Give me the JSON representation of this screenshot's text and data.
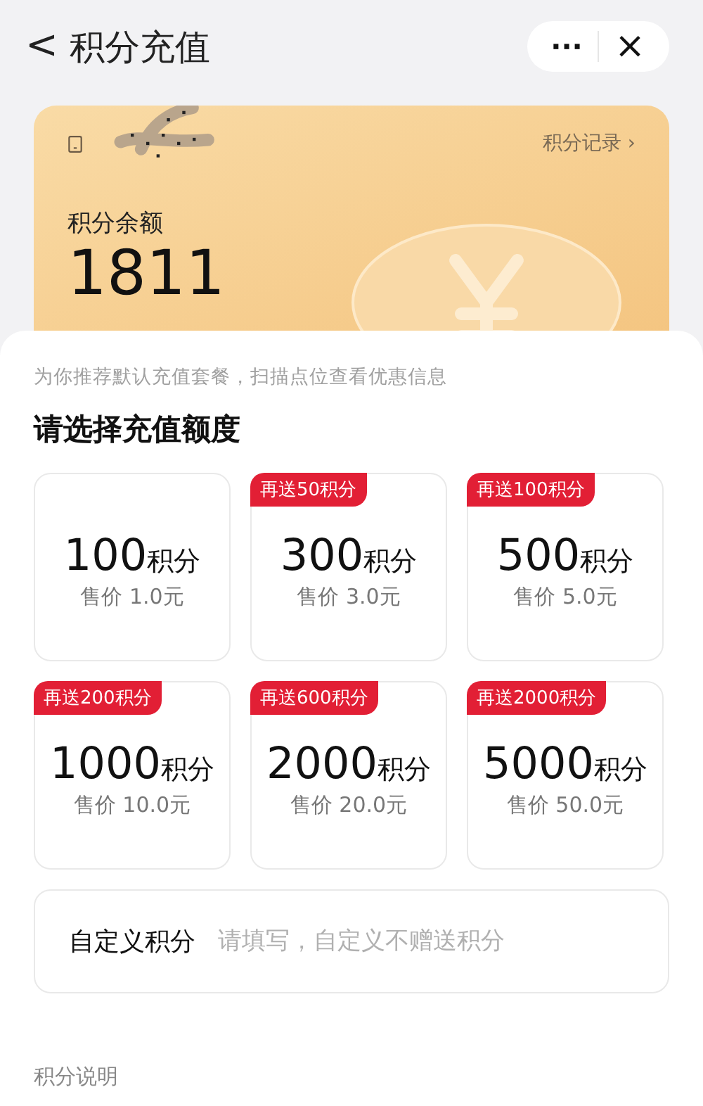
{
  "header": {
    "back": "<",
    "title": "积分充值",
    "more": "···",
    "close": "×"
  },
  "account": {
    "record_link": "积分记录 ›",
    "balance_label": "积分余额",
    "balance": "1811"
  },
  "hint": "为你推荐默认充值套餐，扫描点位查看优惠信息",
  "section_title": "请选择充值额度",
  "packages": [
    {
      "amount": "100",
      "unit": "积分",
      "price": "售价 1.0元"
    },
    {
      "tag": "再送50积分",
      "amount": "300",
      "unit": "积分",
      "price": "售价 3.0元"
    },
    {
      "tag": "再送100积分",
      "amount": "500",
      "unit": "积分",
      "price": "售价 5.0元"
    },
    {
      "tag": "再送200积分",
      "amount": "1000",
      "unit": "积分",
      "price": "售价 10.0元"
    },
    {
      "tag": "再送600积分",
      "amount": "2000",
      "unit": "积分",
      "price": "售价 20.0元"
    },
    {
      "tag": "再送2000积分",
      "amount": "5000",
      "unit": "积分",
      "price": "售价 50.0元"
    }
  ],
  "custom": {
    "label": "自定义积分",
    "placeholder": "请填写，自定义不赠送积分"
  },
  "footer_title": "积分说明"
}
